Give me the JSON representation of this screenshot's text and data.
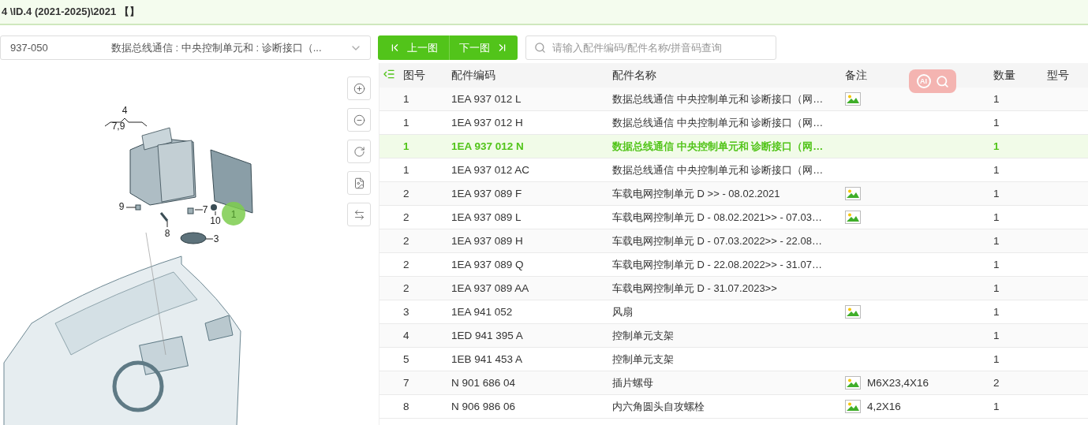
{
  "breadcrumb": "4 \\ID.4 (2021-2025)\\2021 【】",
  "diagram_select": {
    "code": "937-050",
    "title": "数据总线通信 : 中央控制单元和 : 诊断接口（..."
  },
  "nav_buttons": [
    {
      "kind": "prev",
      "label": "上一图"
    },
    {
      "kind": "next",
      "label": "下一图"
    }
  ],
  "search": {
    "placeholder": "请输入配件编码/配件名称/拼音码查询"
  },
  "diagram": {
    "callouts": [
      {
        "label": "4",
        "kind": "text"
      },
      {
        "label": "7,9",
        "kind": "text"
      },
      {
        "label": "9",
        "kind": "text"
      },
      {
        "label": "7",
        "kind": "text"
      },
      {
        "label": "10",
        "kind": "text"
      },
      {
        "label": "8",
        "kind": "text"
      },
      {
        "label": "3",
        "kind": "text"
      },
      {
        "label": "1",
        "kind": "marker"
      }
    ]
  },
  "tools": [
    {
      "kind": "zoom-in"
    },
    {
      "kind": "zoom-out"
    },
    {
      "kind": "reset"
    },
    {
      "kind": "export"
    },
    {
      "kind": "swap"
    }
  ],
  "ai_widget": {
    "label": "AI"
  },
  "table": {
    "columns": [
      "图号",
      "配件编码",
      "配件名称",
      "备注",
      "数量",
      "型号"
    ],
    "rows": [
      {
        "no": "1",
        "code": "1EA 937 012 L",
        "name": "数据总线通信 中央控制单元和 诊断接口（网…",
        "image": true,
        "note": "",
        "qty": "1",
        "selected": false
      },
      {
        "no": "1",
        "code": "1EA 937 012 H",
        "name": "数据总线通信 中央控制单元和 诊断接口（网…",
        "image": false,
        "note": "",
        "qty": "1",
        "selected": false
      },
      {
        "no": "1",
        "code": "1EA 937 012 N",
        "name": "数据总线通信 中央控制单元和 诊断接口（网…",
        "image": false,
        "note": "",
        "qty": "1",
        "selected": true
      },
      {
        "no": "1",
        "code": "1EA 937 012 AC",
        "name": "数据总线通信 中央控制单元和 诊断接口（网…",
        "image": false,
        "note": "",
        "qty": "1",
        "selected": false
      },
      {
        "no": "2",
        "code": "1EA 937 089 F",
        "name": "车载电网控制单元 D >> - 08.02.2021",
        "image": true,
        "note": "",
        "qty": "1",
        "selected": false
      },
      {
        "no": "2",
        "code": "1EA 937 089 L",
        "name": "车载电网控制单元 D - 08.02.2021>> - 07.03…",
        "image": true,
        "note": "",
        "qty": "1",
        "selected": false
      },
      {
        "no": "2",
        "code": "1EA 937 089 H",
        "name": "车载电网控制单元 D - 07.03.2022>> - 22.08…",
        "image": false,
        "note": "",
        "qty": "1",
        "selected": false
      },
      {
        "no": "2",
        "code": "1EA 937 089 Q",
        "name": "车载电网控制单元 D - 22.08.2022>> - 31.07…",
        "image": false,
        "note": "",
        "qty": "1",
        "selected": false
      },
      {
        "no": "2",
        "code": "1EA 937 089 AA",
        "name": "车载电网控制单元 D - 31.07.2023>>",
        "image": false,
        "note": "",
        "qty": "1",
        "selected": false
      },
      {
        "no": "3",
        "code": "1EA 941 052",
        "name": "风扇",
        "image": true,
        "note": "",
        "qty": "1",
        "selected": false
      },
      {
        "no": "4",
        "code": "1ED 941 395 A",
        "name": "控制单元支架",
        "image": false,
        "note": "",
        "qty": "1",
        "selected": false
      },
      {
        "no": "5",
        "code": "1EB 941 453 A",
        "name": "控制单元支架",
        "image": false,
        "note": "",
        "qty": "1",
        "selected": false
      },
      {
        "no": "7",
        "code": "N 901 686 04",
        "name": "插片螺母",
        "image": true,
        "note": "M6X23,4X16",
        "qty": "2",
        "selected": false
      },
      {
        "no": "8",
        "code": "N 906 986 06",
        "name": "内六角圆头自攻螺栓",
        "image": true,
        "note": "4,2X16",
        "qty": "1",
        "selected": false
      }
    ]
  }
}
